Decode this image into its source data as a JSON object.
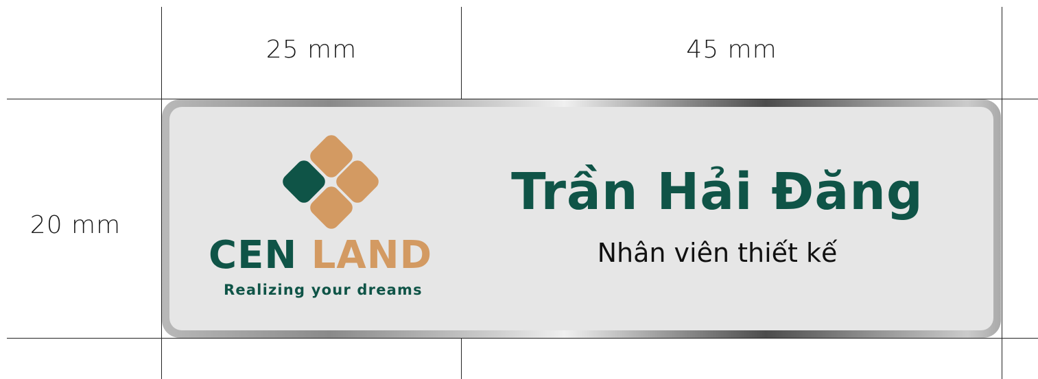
{
  "dimensions": {
    "width_label": "25 mm",
    "width2_label": "45 mm",
    "height_label": "20 mm"
  },
  "logo": {
    "brand_part1": "CEN",
    "brand_part2": "LAND",
    "tagline": "Realizing your dreams"
  },
  "badge": {
    "name": "Trần Hải Đăng",
    "title": "Nhân viên thiết kế"
  },
  "colors": {
    "brand_green": "#0f5447",
    "brand_tan": "#d39a62",
    "badge_background": "#e6e6e6"
  }
}
